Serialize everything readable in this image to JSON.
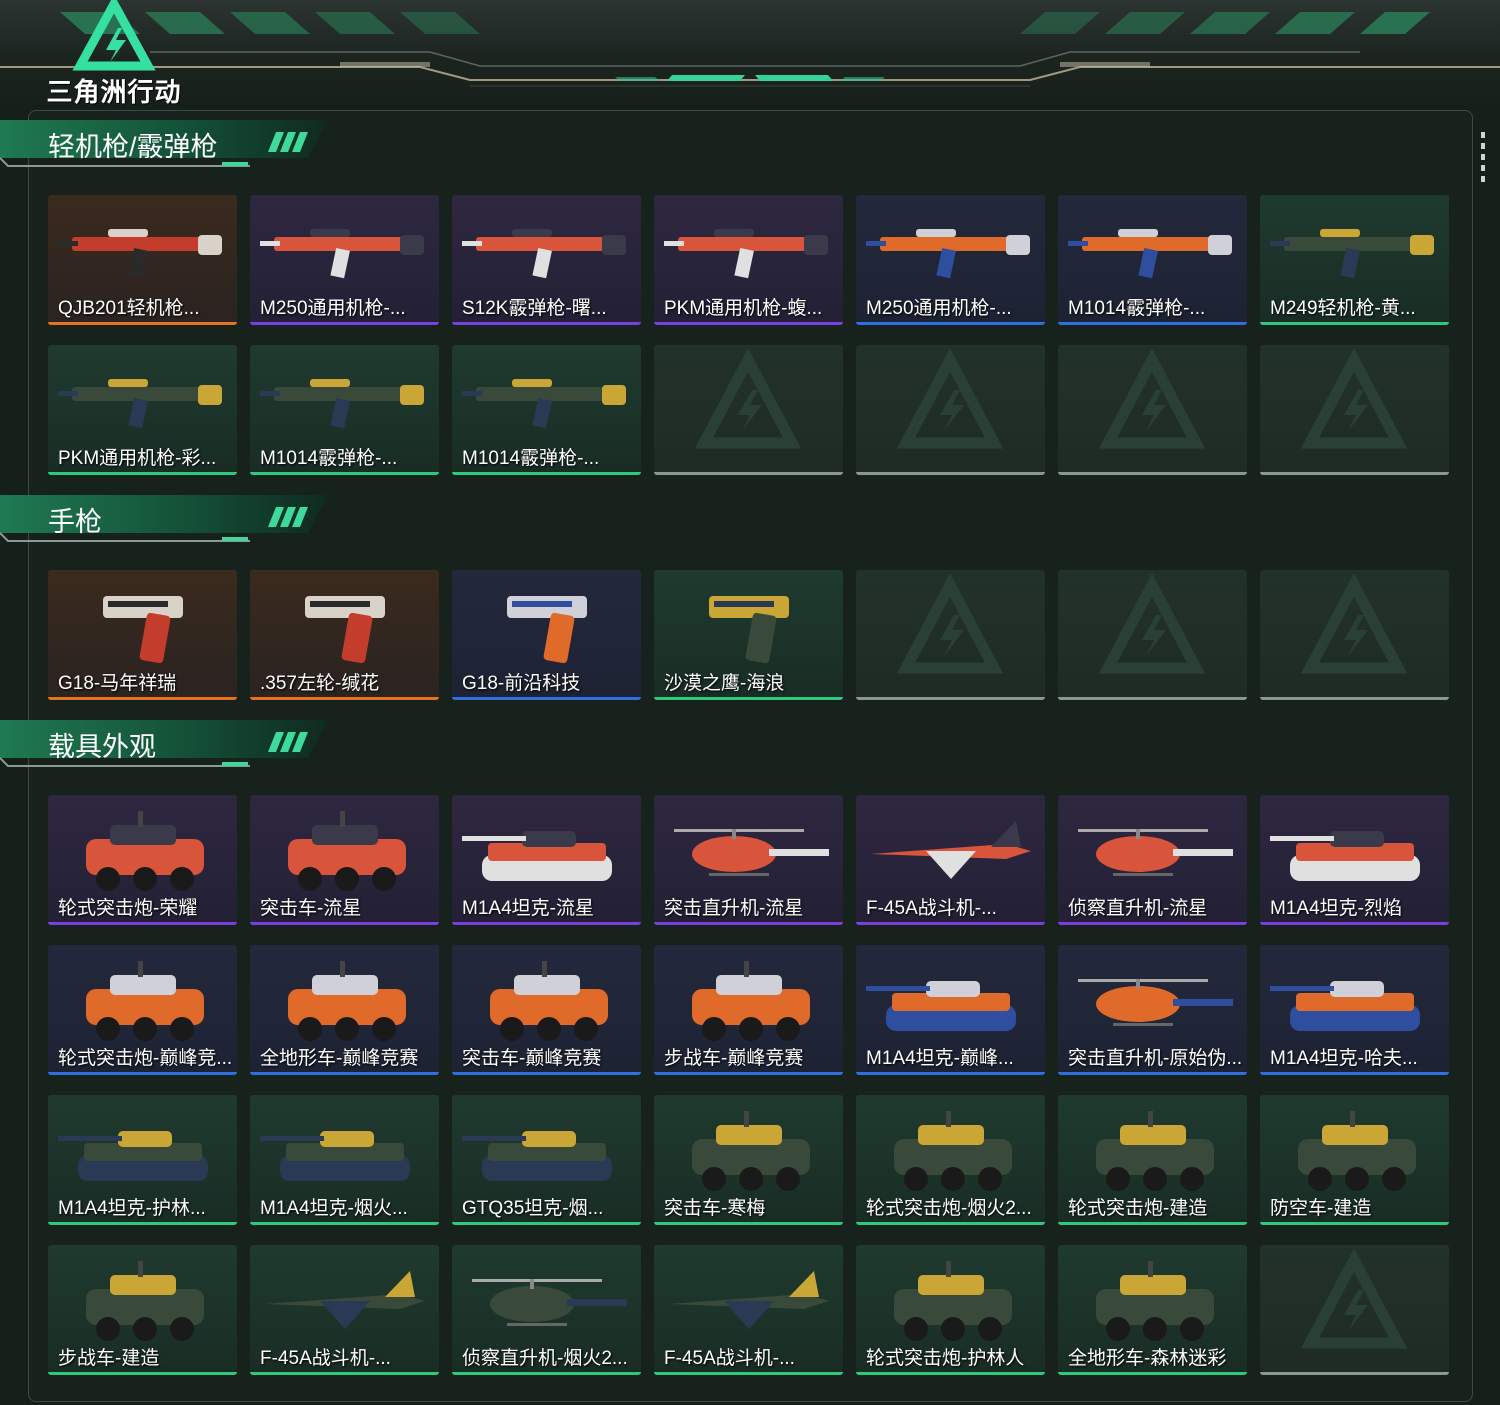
{
  "header": {
    "logo_text": "三角洲行动"
  },
  "rarity_colors": {
    "orange": "#e8731f",
    "purple": "#7b3fe0",
    "blue": "#2f6fe0",
    "green": "#2dc97f",
    "empty": "#8e9692"
  },
  "sections": [
    {
      "title": "轻机枪/霰弹枪",
      "items": [
        {
          "label": "QJB201轻机枪...",
          "rarity": "orange",
          "art": "gun"
        },
        {
          "label": "M250通用机枪-...",
          "rarity": "purple",
          "art": "gun"
        },
        {
          "label": "S12K霰弹枪-曙...",
          "rarity": "purple",
          "art": "gun"
        },
        {
          "label": "PKM通用机枪-蝮...",
          "rarity": "purple",
          "art": "gun"
        },
        {
          "label": "M250通用机枪-...",
          "rarity": "blue",
          "art": "gun"
        },
        {
          "label": "M1014霰弹枪-...",
          "rarity": "blue",
          "art": "gun"
        },
        {
          "label": "M249轻机枪-黄...",
          "rarity": "green",
          "art": "gun"
        },
        {
          "label": "PKM通用机枪-彩...",
          "rarity": "green",
          "art": "gun"
        },
        {
          "label": "M1014霰弹枪-...",
          "rarity": "green",
          "art": "gun"
        },
        {
          "label": "M1014霰弹枪-...",
          "rarity": "green",
          "art": "gun"
        },
        {
          "label": "",
          "rarity": "empty",
          "art": "empty"
        },
        {
          "label": "",
          "rarity": "empty",
          "art": "empty"
        },
        {
          "label": "",
          "rarity": "empty",
          "art": "empty"
        },
        {
          "label": "",
          "rarity": "empty",
          "art": "empty"
        }
      ]
    },
    {
      "title": "手枪",
      "items": [
        {
          "label": "G18-马年祥瑞",
          "rarity": "orange",
          "art": "pistol"
        },
        {
          "label": ".357左轮-缄花",
          "rarity": "orange",
          "art": "pistol"
        },
        {
          "label": "G18-前沿科技",
          "rarity": "blue",
          "art": "pistol"
        },
        {
          "label": "沙漠之鹰-海浪",
          "rarity": "green",
          "art": "pistol"
        },
        {
          "label": "",
          "rarity": "empty",
          "art": "empty"
        },
        {
          "label": "",
          "rarity": "empty",
          "art": "empty"
        },
        {
          "label": "",
          "rarity": "empty",
          "art": "empty"
        }
      ]
    },
    {
      "title": "载具外观",
      "items": [
        {
          "label": "轮式突击炮-荣耀",
          "rarity": "purple",
          "art": "vehicle"
        },
        {
          "label": "突击车-流星",
          "rarity": "purple",
          "art": "vehicle"
        },
        {
          "label": "M1A4坦克-流星",
          "rarity": "purple",
          "art": "tank"
        },
        {
          "label": "突击直升机-流星",
          "rarity": "purple",
          "art": "heli"
        },
        {
          "label": "F-45A战斗机-...",
          "rarity": "purple",
          "art": "jet"
        },
        {
          "label": "侦察直升机-流星",
          "rarity": "purple",
          "art": "heli"
        },
        {
          "label": "M1A4坦克-烈焰",
          "rarity": "purple",
          "art": "tank"
        },
        {
          "label": "轮式突击炮-巅峰竞...",
          "rarity": "blue",
          "art": "vehicle"
        },
        {
          "label": "全地形车-巅峰竞赛",
          "rarity": "blue",
          "art": "vehicle"
        },
        {
          "label": "突击车-巅峰竞赛",
          "rarity": "blue",
          "art": "vehicle"
        },
        {
          "label": "步战车-巅峰竞赛",
          "rarity": "blue",
          "art": "vehicle"
        },
        {
          "label": "M1A4坦克-巅峰...",
          "rarity": "blue",
          "art": "tank"
        },
        {
          "label": "突击直升机-原始伪...",
          "rarity": "blue",
          "art": "heli"
        },
        {
          "label": "M1A4坦克-哈夫...",
          "rarity": "blue",
          "art": "tank"
        },
        {
          "label": "M1A4坦克-护林...",
          "rarity": "green",
          "art": "tank"
        },
        {
          "label": "M1A4坦克-烟火...",
          "rarity": "green",
          "art": "tank"
        },
        {
          "label": "GTQ35坦克-烟...",
          "rarity": "green",
          "art": "tank"
        },
        {
          "label": "突击车-寒梅",
          "rarity": "green",
          "art": "vehicle"
        },
        {
          "label": "轮式突击炮-烟火2...",
          "rarity": "green",
          "art": "vehicle"
        },
        {
          "label": "轮式突击炮-建造",
          "rarity": "green",
          "art": "vehicle"
        },
        {
          "label": "防空车-建造",
          "rarity": "green",
          "art": "vehicle"
        },
        {
          "label": "步战车-建造",
          "rarity": "green",
          "art": "vehicle"
        },
        {
          "label": "F-45A战斗机-...",
          "rarity": "green",
          "art": "jet"
        },
        {
          "label": "侦察直升机-烟火2...",
          "rarity": "green",
          "art": "heli"
        },
        {
          "label": "F-45A战斗机-...",
          "rarity": "green",
          "art": "jet"
        },
        {
          "label": "轮式突击炮-护林人",
          "rarity": "green",
          "art": "vehicle"
        },
        {
          "label": "全地形车-森林迷彩",
          "rarity": "green",
          "art": "vehicle"
        },
        {
          "label": "",
          "rarity": "empty",
          "art": "empty"
        }
      ]
    }
  ]
}
